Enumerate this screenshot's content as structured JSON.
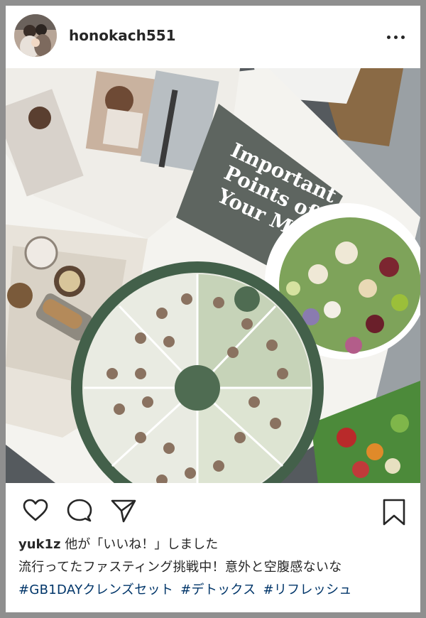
{
  "post": {
    "username": "honokach551",
    "image_title": {
      "line1": "Important",
      "line2": "Points of",
      "line3": "Your Meal"
    },
    "likes": {
      "user": "yuk1z",
      "text": " 他が「いいね！」しました"
    },
    "caption": "流行ってたファスティング挑戦中！意外と空腹感ないな",
    "hashtags": [
      "#GB1DAYクレンズセット",
      "#デトックス",
      "#リフレッシュ"
    ]
  },
  "icons": {
    "more": "more-options-icon",
    "like": "heart-icon",
    "comment": "comment-icon",
    "share": "paper-plane-icon",
    "save": "bookmark-icon"
  },
  "colors": {
    "text": "#262626",
    "hashtag": "#003569",
    "frame": "#8f8f8f"
  }
}
